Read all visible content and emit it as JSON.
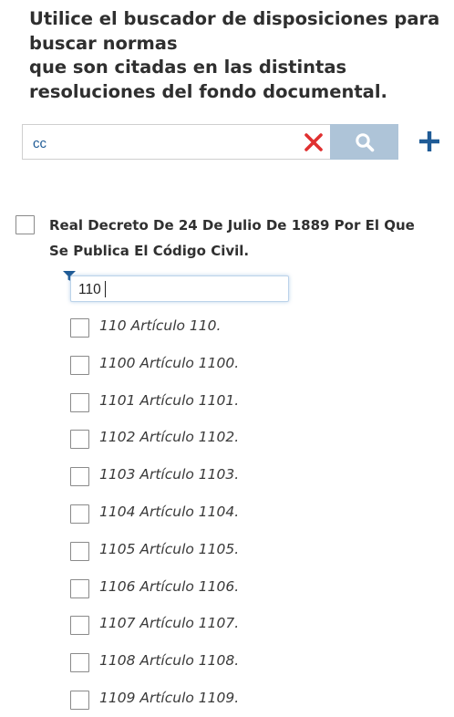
{
  "intro": {
    "lines": [
      "Utilice el buscador de disposiciones para",
      "buscar normas",
      "que son citadas en las distintas",
      "resoluciones del fondo documental."
    ]
  },
  "search": {
    "value": "cc",
    "clear_icon": "close-icon",
    "search_icon": "magnifier-icon",
    "add_icon": "plus-icon",
    "colors": {
      "search_button_bg": "#aec4d8",
      "clear_icon": "#e03030",
      "add_icon": "#1f5b96",
      "input_text": "#1f5b96"
    }
  },
  "result": {
    "title_lines": [
      "Real Decreto De 24 De Julio De 1889 Por El Que",
      "Se Publica El Código Civil."
    ],
    "filter": {
      "value": "110",
      "icon": "filter-icon",
      "icon_color": "#1f5b96"
    },
    "articles": [
      {
        "label": "110 Artículo 110."
      },
      {
        "label": "1100 Artículo 1100."
      },
      {
        "label": "1101 Artículo 1101."
      },
      {
        "label": "1102 Artículo 1102."
      },
      {
        "label": "1103 Artículo 1103."
      },
      {
        "label": "1104 Artículo 1104."
      },
      {
        "label": "1105 Artículo 1105."
      },
      {
        "label": "1106 Artículo 1106."
      },
      {
        "label": "1107 Artículo 1107."
      },
      {
        "label": "1108 Artículo 1108."
      },
      {
        "label": "1109 Artículo 1109."
      }
    ]
  }
}
